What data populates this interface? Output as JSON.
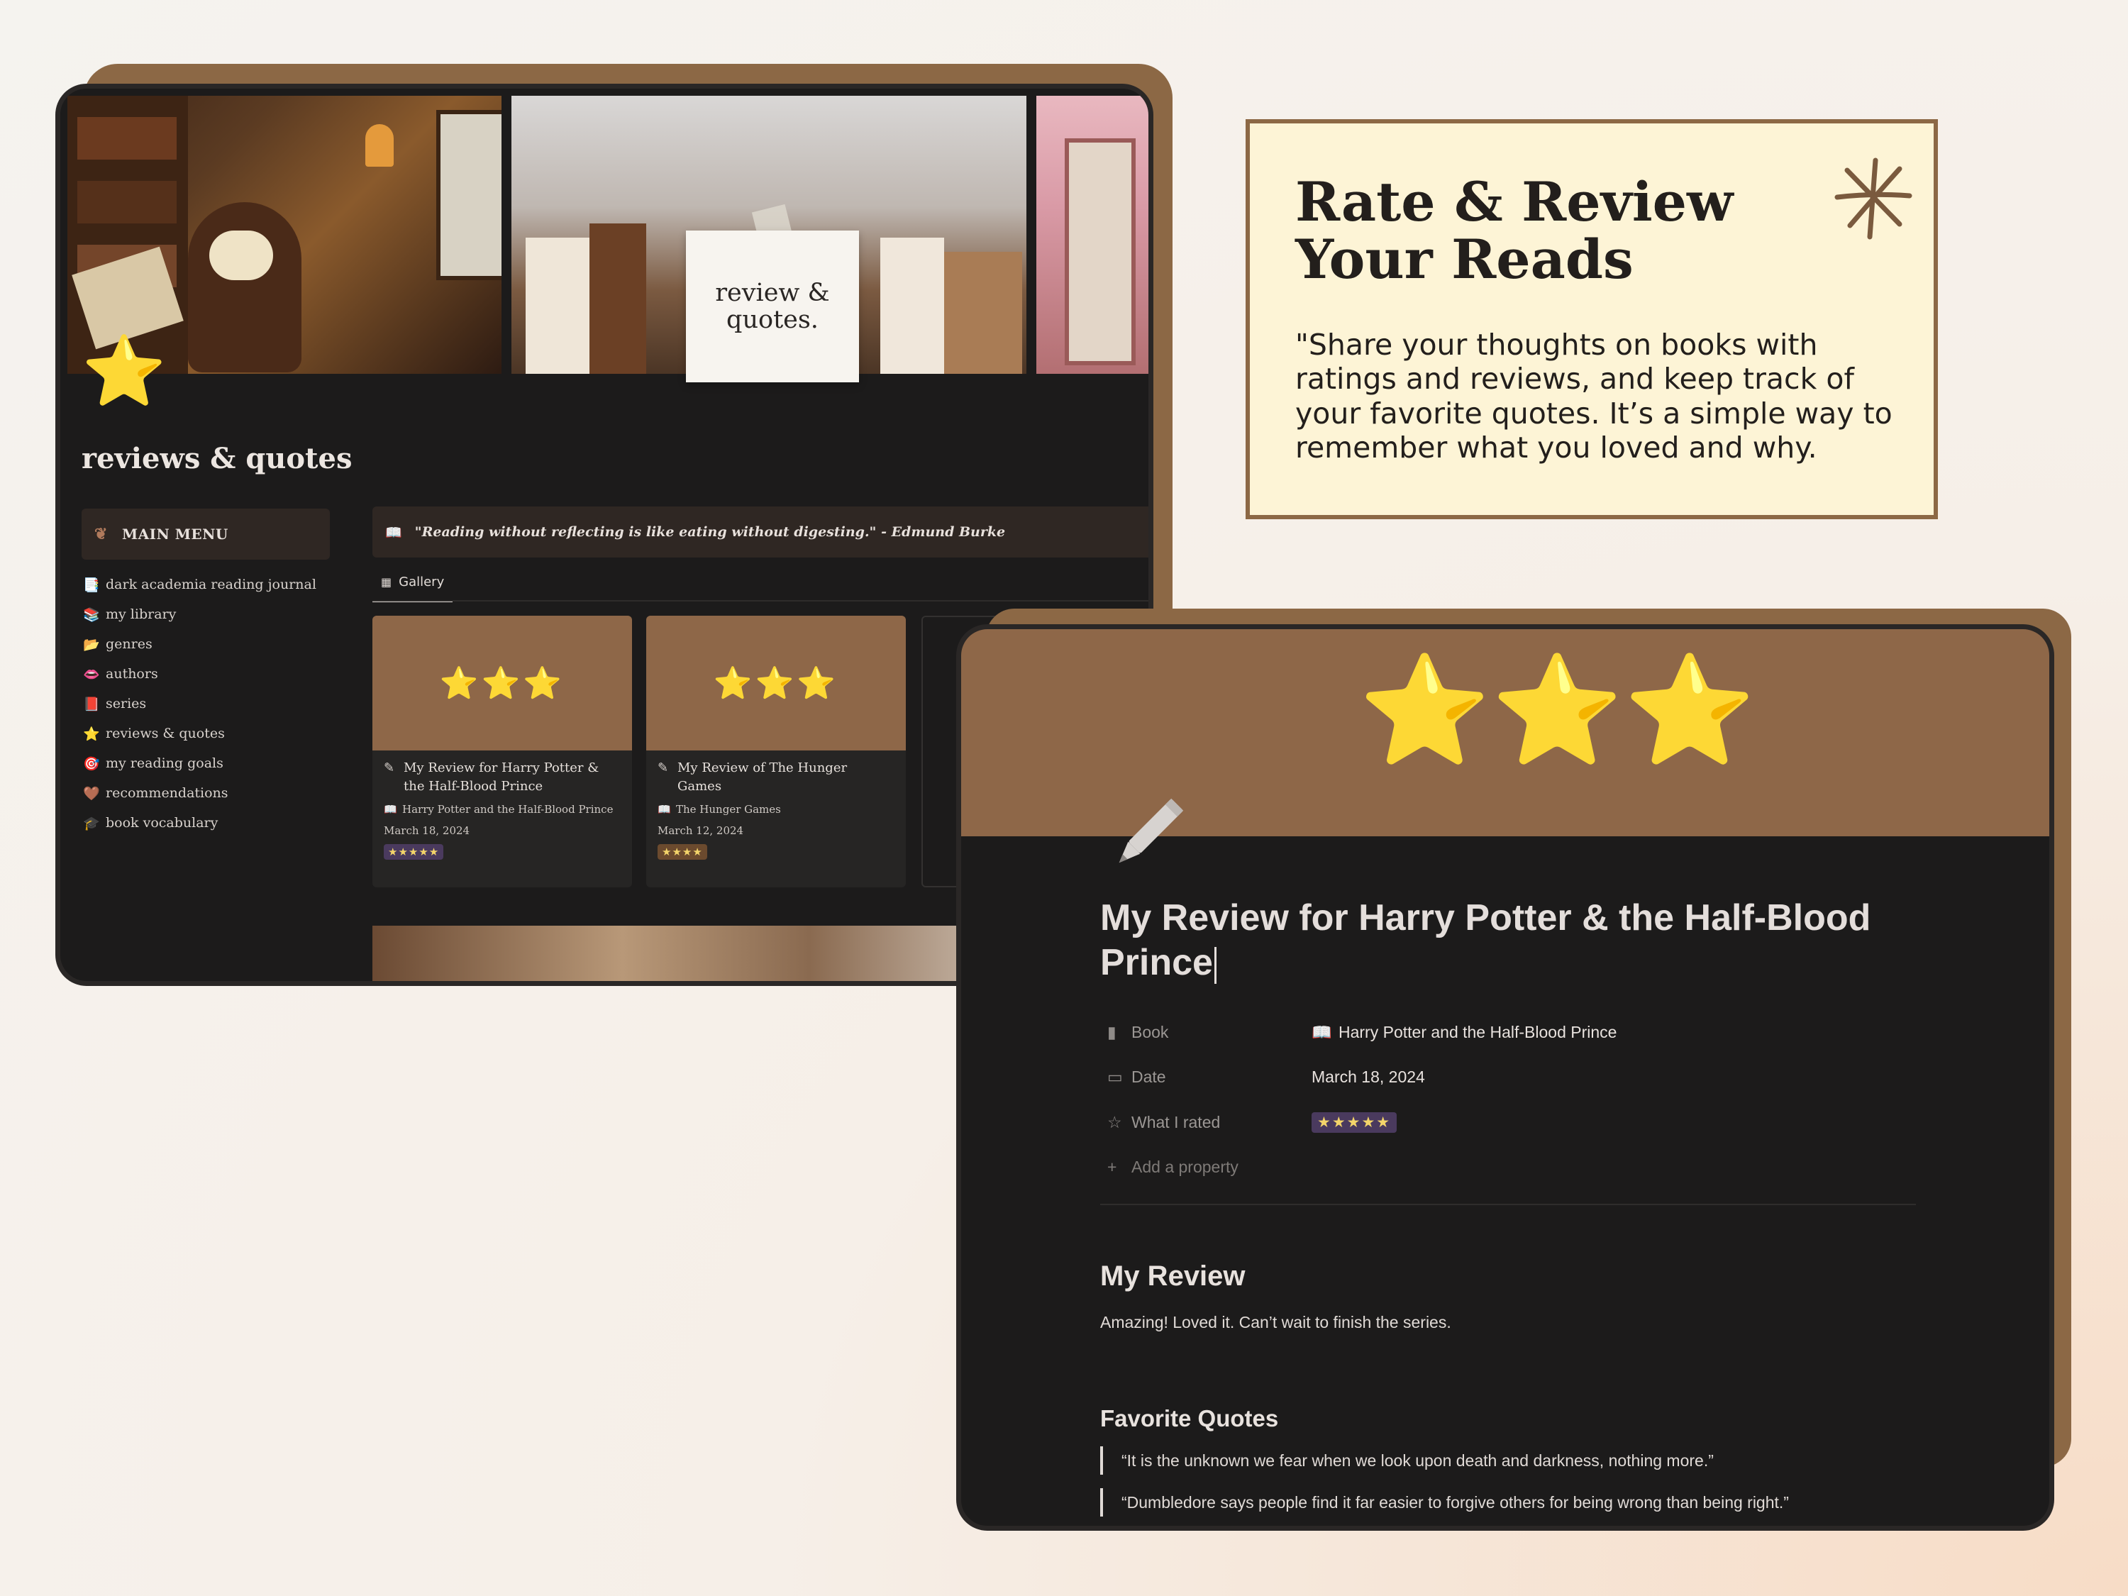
{
  "notion_page": {
    "banner_note": "review &\nquotes.",
    "page_icon": "⭐",
    "title": "reviews & quotes",
    "menu": {
      "header": "MAIN MENU",
      "items": [
        {
          "icon": "📑",
          "label": "dark academia reading journal"
        },
        {
          "icon": "📚",
          "label": "my library"
        },
        {
          "icon": "📂",
          "label": "genres"
        },
        {
          "icon": "👄",
          "label": "authors"
        },
        {
          "icon": "📕",
          "label": "series"
        },
        {
          "icon": "⭐",
          "label": "reviews & quotes"
        },
        {
          "icon": "🎯",
          "label": "my reading goals"
        },
        {
          "icon": "🤎",
          "label": "recommendations"
        },
        {
          "icon": "🎓",
          "label": "book vocabulary"
        }
      ]
    },
    "quote": "\"Reading without reflecting is like eating without digesting.\" - Edmund Burke",
    "view_tab": "Gallery",
    "cards": [
      {
        "cover": "⭐⭐⭐",
        "title": "My Review for Harry Potter & the Half-Blood Prince",
        "book": "Harry Potter and the Half-Blood Prince",
        "date": "March 18, 2024",
        "rating": "★★★★★"
      },
      {
        "cover": "⭐⭐⭐",
        "title": "My Review of The Hunger Games",
        "book": "The Hunger Games",
        "date": "March 12, 2024",
        "rating": "★★★★"
      }
    ]
  },
  "info_card": {
    "title": "Rate & Review Your Reads",
    "text": "\"Share your thoughts on books with ratings and reviews, and keep track of your favorite quotes. It’s a simple way to remember what you loved and why."
  },
  "review_page": {
    "cover_stars": "⭐⭐⭐",
    "title": "My Review for Harry Potter & the Half-Blood Prince",
    "properties": {
      "book_label": "Book",
      "book_value": "Harry Potter and the Half-Blood Prince",
      "date_label": "Date",
      "date_value": "March 18, 2024",
      "rated_label": "What I rated",
      "rated_value": "★★★★★",
      "add_label": "Add a property"
    },
    "review_heading": "My Review",
    "review_text": "Amazing! Loved it. Can’t wait to finish the series.",
    "quotes_heading": "Favorite Quotes",
    "quotes": [
      "“It is the unknown we fear when we look upon death and darkness, nothing more.”",
      "“Dumbledore says people find it far easier to forgive others for being wrong than being right.”"
    ]
  },
  "colors": {
    "frame_brown": "#8c6845",
    "cover_brown": "#8e6748",
    "star_yellow": "#f6d32a",
    "card_cream": "#fdf4d6",
    "dark_bg": "#1c1b1b"
  }
}
